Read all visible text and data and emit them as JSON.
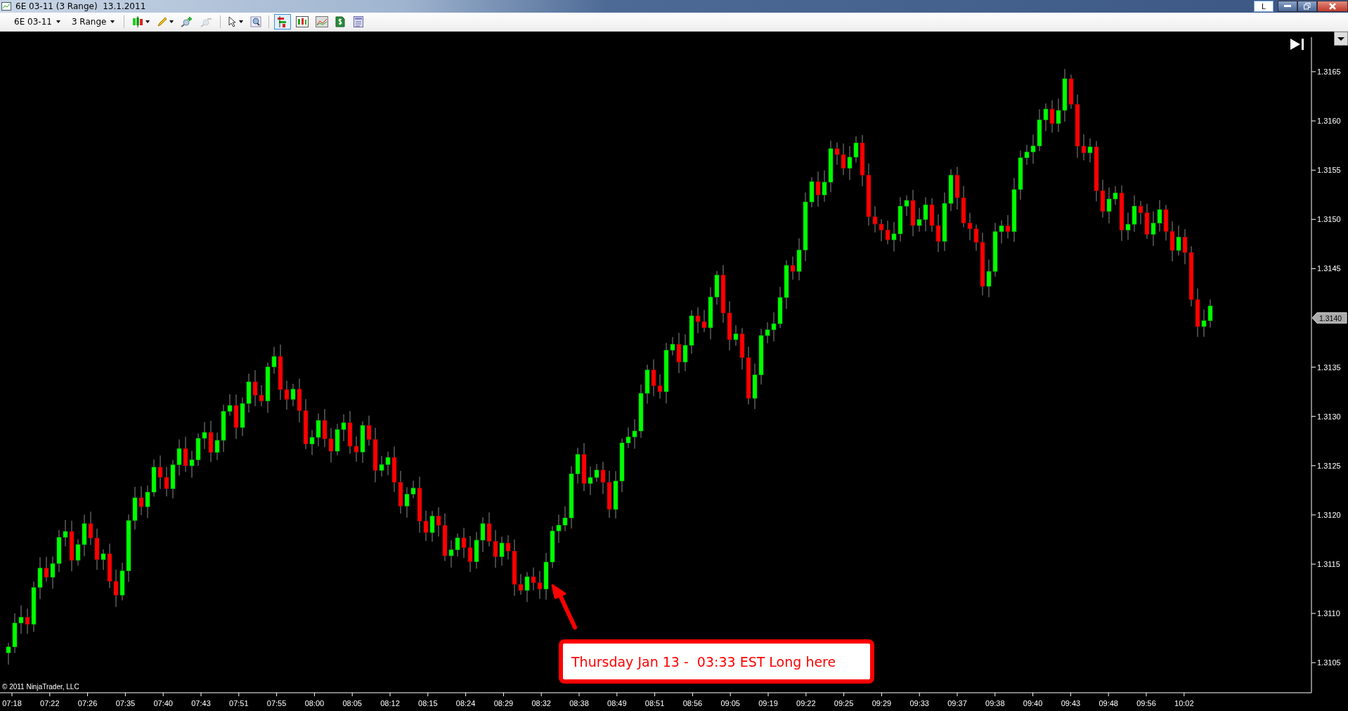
{
  "window": {
    "title": "6E 03-11 (3 Range)  13.1.2011",
    "layout_button": "L"
  },
  "toolbar": {
    "instrument": "6E 03-11",
    "period": "3 Range",
    "tools": [
      {
        "kind": "candles",
        "selected": false,
        "disabled": false
      },
      {
        "kind": "pencil",
        "selected": false,
        "disabled": false
      },
      {
        "kind": "zoom-in",
        "selected": false,
        "disabled": false
      },
      {
        "kind": "zoom-out",
        "selected": false,
        "disabled": true
      },
      {
        "kind": "pointer",
        "selected": false,
        "disabled": false
      },
      {
        "kind": "magnifier",
        "selected": false,
        "disabled": false
      },
      {
        "kind": "order-bars",
        "selected": true,
        "disabled": false
      },
      {
        "kind": "data-box",
        "selected": false,
        "disabled": false
      },
      {
        "kind": "chart",
        "selected": false,
        "disabled": false
      },
      {
        "kind": "dollar",
        "selected": false,
        "disabled": false
      },
      {
        "kind": "properties",
        "selected": false,
        "disabled": false
      }
    ]
  },
  "chart": {
    "price_labels": [
      "1.3165",
      "1.3160",
      "1.3155",
      "1.3150",
      "1.3145",
      "1.3135",
      "1.3130",
      "1.3125",
      "1.3120",
      "1.3115",
      "1.3110",
      "1.3105"
    ],
    "current_price": "1.3140",
    "time_labels": [
      "07:18",
      "07:22",
      "07:26",
      "07:35",
      "07:40",
      "07:43",
      "07:51",
      "07:55",
      "08:00",
      "08:05",
      "08:12",
      "08:15",
      "08:24",
      "08:29",
      "08:32",
      "08:38",
      "08:49",
      "08:51",
      "08:56",
      "09:05",
      "09:19",
      "09:22",
      "09:25",
      "09:29",
      "09:33",
      "09:37",
      "09:38",
      "09:40",
      "09:43",
      "09:48",
      "09:56",
      "10:02"
    ],
    "copyright": "© 2011 NinjaTrader, LLC",
    "annotation": "Thursday Jan 13 -  03:33 EST Long here"
  }
}
